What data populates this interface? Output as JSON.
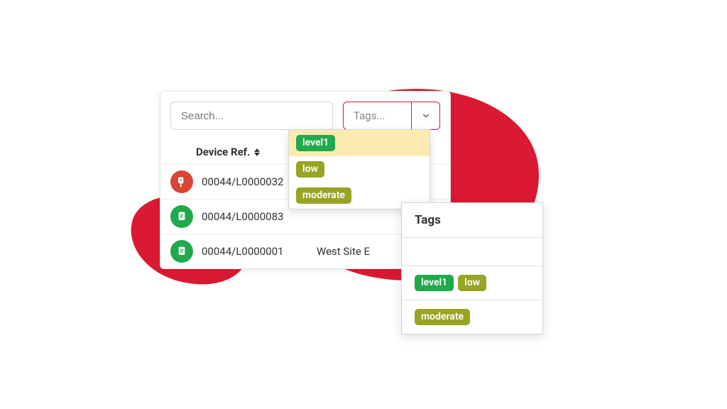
{
  "filters": {
    "search_placeholder": "Search...",
    "tags_placeholder": "Tags..."
  },
  "table": {
    "header_device_ref": "Device Ref.",
    "rows": [
      {
        "icon": "device-red",
        "ref": "00044/L0000032",
        "name": ""
      },
      {
        "icon": "device-green",
        "ref": "00044/L0000083",
        "name": ""
      },
      {
        "icon": "device-green",
        "ref": "00044/L0000001",
        "name": "West Site E"
      }
    ]
  },
  "dropdown": {
    "options": [
      {
        "label": "level1",
        "color": "green",
        "highlighted": true
      },
      {
        "label": "low",
        "color": "olive",
        "highlighted": false
      },
      {
        "label": "moderate",
        "color": "olive",
        "highlighted": false
      }
    ]
  },
  "tags_panel": {
    "header": "Tags",
    "rows": [
      [],
      [
        {
          "label": "level1",
          "color": "green"
        },
        {
          "label": "low",
          "color": "olive"
        }
      ],
      [
        {
          "label": "moderate",
          "color": "olive"
        }
      ]
    ]
  }
}
